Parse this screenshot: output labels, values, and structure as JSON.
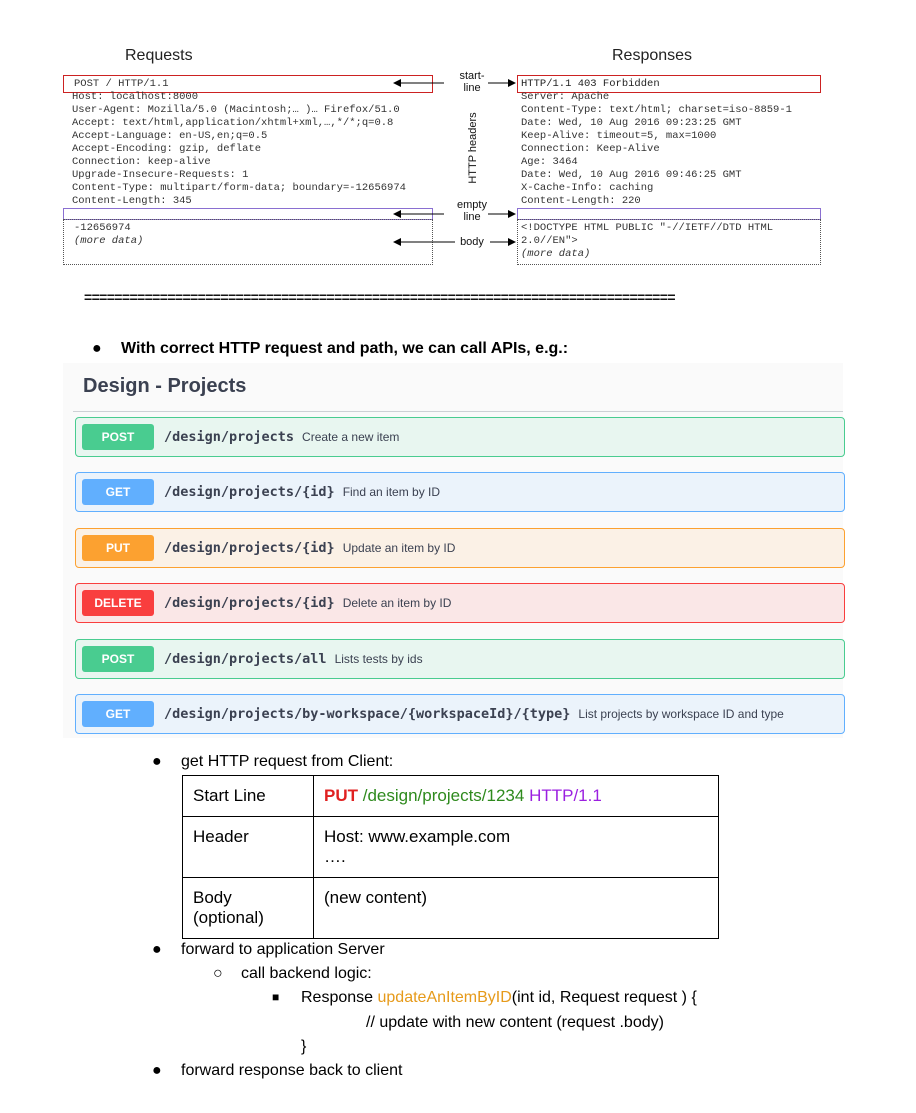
{
  "diagram": {
    "requests_title": "Requests",
    "responses_title": "Responses",
    "request_start": "POST / HTTP/1.1",
    "request_headers": [
      "Host: localhost:8000",
      "User-Agent: Mozilla/5.0 (Macintosh;… )… Firefox/51.0",
      "Accept: text/html,application/xhtml+xml,…,*/*;q=0.8",
      "Accept-Language: en-US,en;q=0.5",
      "Accept-Encoding: gzip, deflate",
      "Connection: keep-alive",
      "Upgrade-Insecure-Requests: 1",
      "Content-Type: multipart/form-data; boundary=-12656974",
      "Content-Length: 345"
    ],
    "request_body": [
      "-12656974",
      "(more data)"
    ],
    "response_start": "HTTP/1.1 403 Forbidden",
    "response_headers": [
      "Server: Apache",
      "Content-Type: text/html; charset=iso-8859-1",
      "Date: Wed, 10 Aug 2016 09:23:25 GMT",
      "Keep-Alive: timeout=5, max=1000",
      "Connection: Keep-Alive",
      "Age: 3464",
      "Date: Wed, 10 Aug 2016 09:46:25 GMT",
      "X-Cache-Info: caching",
      "Content-Length: 220"
    ],
    "response_body": [
      "<!DOCTYPE HTML PUBLIC \"-//IETF//DTD HTML",
      "2.0//EN\">",
      "(more data)"
    ],
    "label_start_line": [
      "start-",
      "line"
    ],
    "label_http_headers": "HTTP headers",
    "label_empty_line": [
      "empty",
      "line"
    ],
    "label_body": "body"
  },
  "separator": "==============================================================================",
  "bullet_api": "With correct HTTP request and path, we can call APIs, e.g.:",
  "swagger": {
    "title": "Design - Projects",
    "operations": [
      {
        "method": "POST",
        "path": "/design/projects",
        "summary": "Create a new item"
      },
      {
        "method": "GET",
        "path": "/design/projects/{id}",
        "summary": "Find an item by ID"
      },
      {
        "method": "PUT",
        "path": "/design/projects/{id}",
        "summary": "Update an item by ID"
      },
      {
        "method": "DELETE",
        "path": "/design/projects/{id}",
        "summary": "Delete an item by ID"
      },
      {
        "method": "POST",
        "path": "/design/projects/all",
        "summary": "Lists tests by ids"
      },
      {
        "method": "GET",
        "path": "/design/projects/by-workspace/{workspaceId}/{type}",
        "summary": "List projects by workspace ID and type"
      }
    ],
    "colors": {
      "POST": {
        "badge": "#49cc90",
        "bg": "#e8f6f0",
        "border": "#49cc90"
      },
      "GET": {
        "badge": "#61affe",
        "bg": "#ebf3fb",
        "border": "#61affe"
      },
      "PUT": {
        "badge": "#fca130",
        "bg": "#fbf1e6",
        "border": "#fca130"
      },
      "DELETE": {
        "badge": "#f93e3e",
        "bg": "#fae7e7",
        "border": "#f93e3e"
      }
    }
  },
  "bullet_get_request": "get HTTP request from Client:",
  "request_table": {
    "start_line_label": "Start Line",
    "start_method": "PUT",
    "start_path": " /design/projects/1234 ",
    "start_version": "HTTP/1.1",
    "header_label": "Header",
    "header_value": "Host: www.example.com",
    "header_more": "….",
    "body_label_1": "Body",
    "body_label_2": "(optional)",
    "body_value": "(new content)"
  },
  "bullet_forward_app": "forward to application Server",
  "sub_backend": "call backend logic:",
  "code_line_prefix": "Response ",
  "code_fn": "updateAnItemByID",
  "code_line_suffix": "(int id, Request request ) {",
  "code_comment": "// update with new content (request .body)",
  "code_close": "}",
  "bullet_forward_back": "forward response back to client"
}
